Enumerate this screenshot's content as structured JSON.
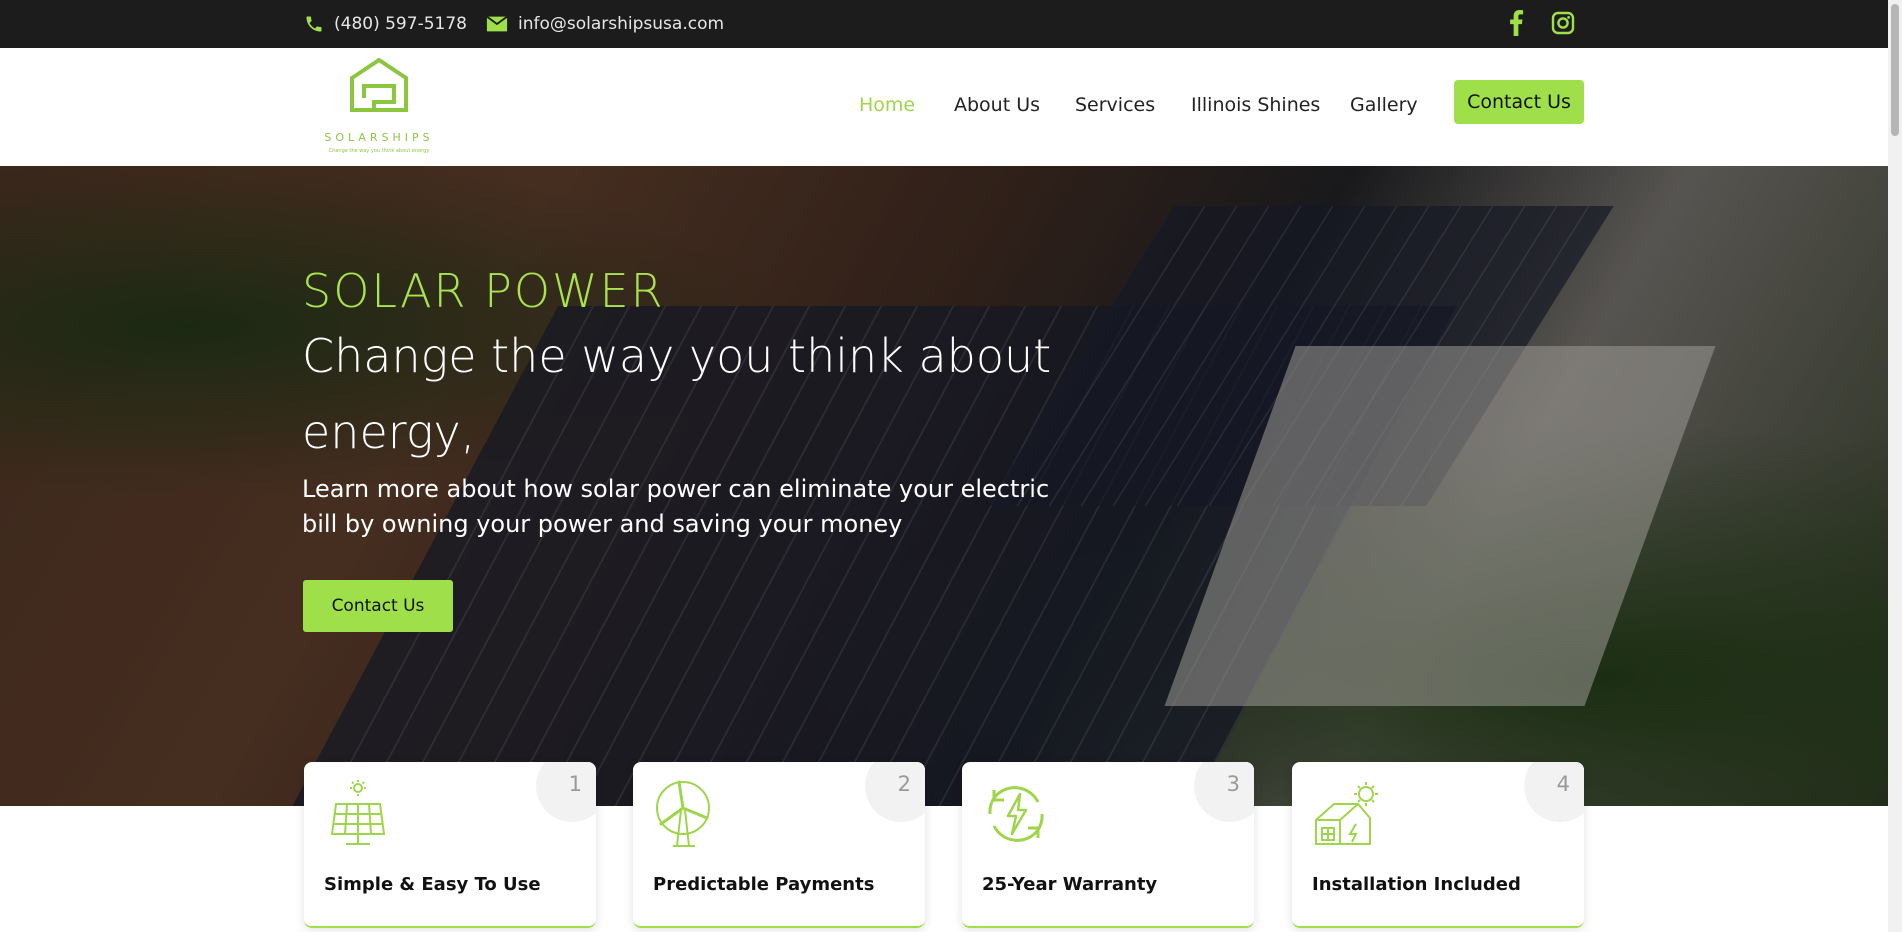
{
  "topbar": {
    "phone": "(480) 597-5178",
    "email": "info@solarshipsusa.com",
    "social": [
      "facebook-icon",
      "instagram-icon"
    ]
  },
  "logo": {
    "wordmark": "SOLARSHIPS",
    "tagline": "Change the way you think about energy"
  },
  "nav": {
    "items": [
      {
        "label": "Home",
        "active": true
      },
      {
        "label": "About Us"
      },
      {
        "label": "Services"
      },
      {
        "label": "Illinois Shines"
      },
      {
        "label": "Gallery"
      }
    ],
    "cta": "Contact Us"
  },
  "hero": {
    "kicker": "SOLAR POWER",
    "title": "Change the way you think about energy,",
    "subtitle": "Learn more about how solar power can eliminate your electric bill by owning your power and saving your money",
    "button": "Contact Us"
  },
  "features": [
    {
      "number": "1",
      "label": "Simple & Easy To Use",
      "icon": "solar-panel-icon"
    },
    {
      "number": "2",
      "label": "Predictable Payments",
      "icon": "wind-turbine-icon"
    },
    {
      "number": "3",
      "label": "25-Year Warranty",
      "icon": "renewable-energy-icon"
    },
    {
      "number": "4",
      "label": "Installation Included",
      "icon": "solar-house-icon"
    }
  ],
  "colors": {
    "accent": "#9fe04a",
    "topbar": "#1c1c1c",
    "nav_active": "#9fd54a"
  }
}
